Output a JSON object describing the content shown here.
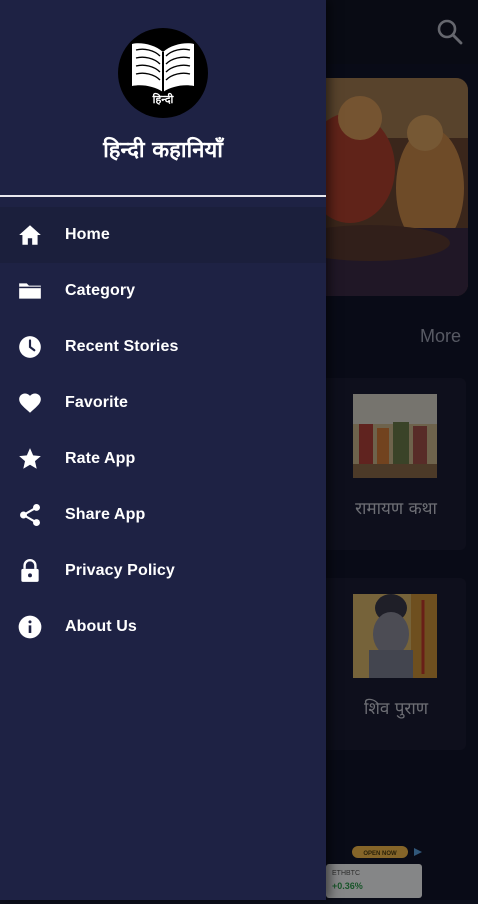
{
  "app": {
    "title": "हिन्दी कहानियाँ",
    "logo_text": "हिन्दी"
  },
  "drawer": {
    "menu": [
      {
        "label": "Home",
        "icon": "home-icon"
      },
      {
        "label": "Category",
        "icon": "folder-icon"
      },
      {
        "label": "Recent Stories",
        "icon": "clock-icon"
      },
      {
        "label": "Favorite",
        "icon": "heart-icon"
      },
      {
        "label": "Rate App",
        "icon": "star-icon"
      },
      {
        "label": "Share App",
        "icon": "share-icon"
      },
      {
        "label": "Privacy Policy",
        "icon": "lock-icon"
      },
      {
        "label": "About Us",
        "icon": "info-icon"
      }
    ],
    "active_index": 0
  },
  "background": {
    "more_label": "More",
    "stories": [
      {
        "title": "रामायण कथा"
      },
      {
        "title": "शिव पुराण"
      }
    ],
    "ad": {
      "badge": "OPEN NOW",
      "ticker": "ETHBTC",
      "change": "+0.36%"
    }
  },
  "colors": {
    "drawer_bg": "#1e2244",
    "app_bg": "#12152a",
    "accent_green": "#2e9b4e"
  }
}
